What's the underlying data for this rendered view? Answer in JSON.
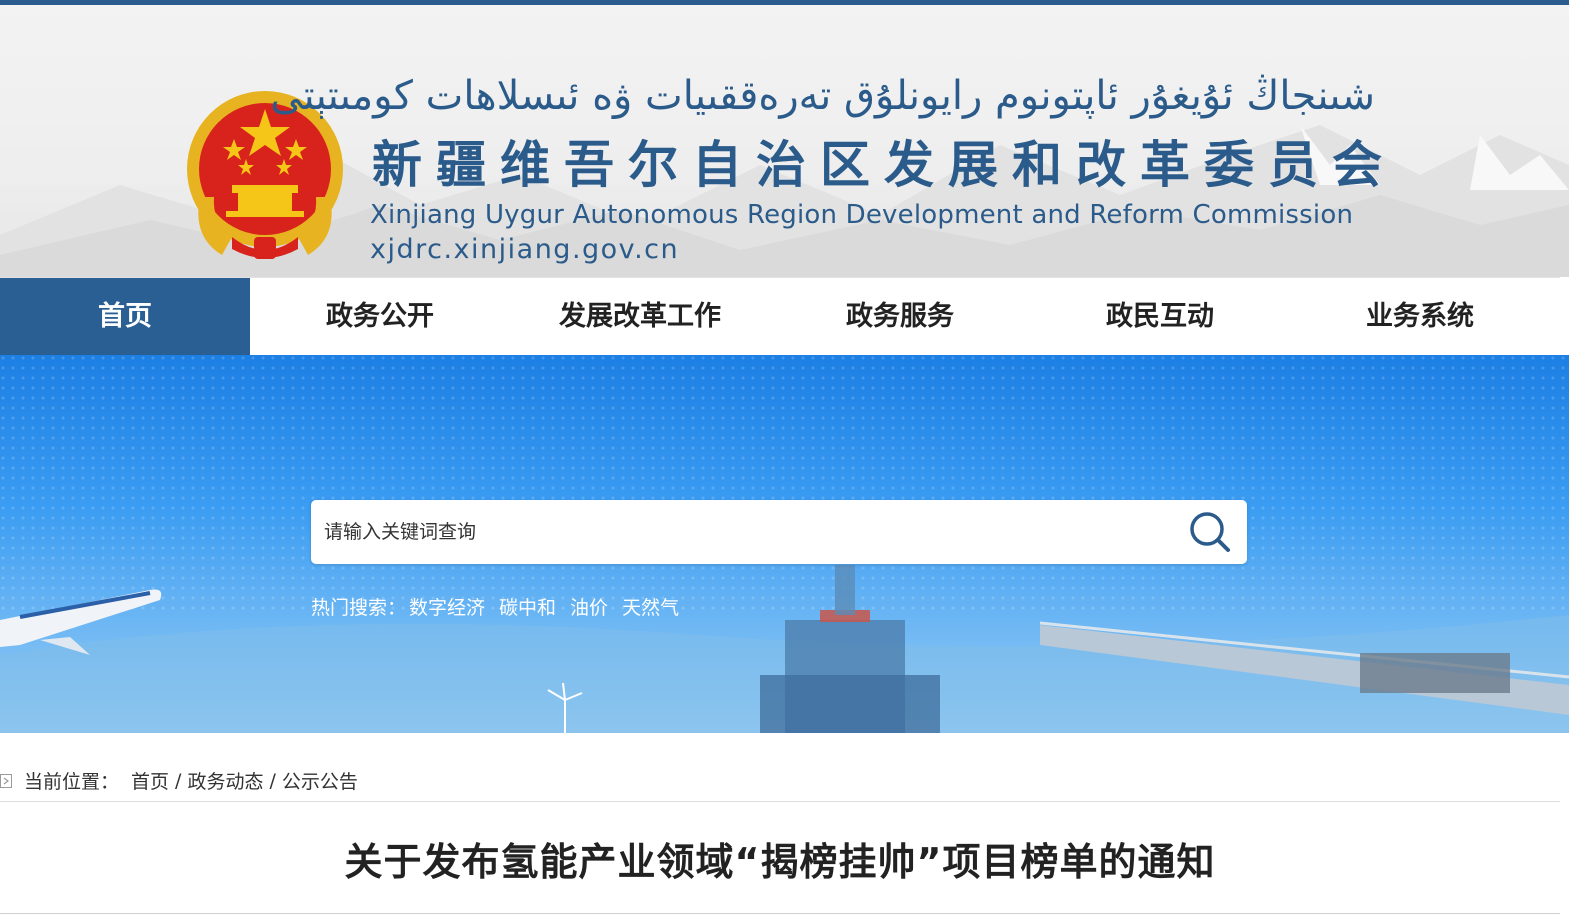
{
  "header": {
    "title_ug": "شىنجاڭ ئۇيغۇر ئاپتونوم رايونلۇق تەرەققىيات ۋە ئىسلاھات كومىتېتى",
    "title_cn": "新疆维吾尔自治区发展和改革委员会",
    "title_en": "Xinjiang Uygur Autonomous Region Development and Reform Commission",
    "url": "xjdrc.xinjiang.gov.cn",
    "emblem_icon": "national-emblem-icon"
  },
  "nav": {
    "items": [
      {
        "label": "首页",
        "active": true
      },
      {
        "label": "政务公开",
        "active": false
      },
      {
        "label": "发展改革工作",
        "active": false
      },
      {
        "label": "政务服务",
        "active": false
      },
      {
        "label": "政民互动",
        "active": false
      },
      {
        "label": "业务系统",
        "active": false
      }
    ]
  },
  "search": {
    "placeholder": "请输入关键词查询",
    "icon": "search-icon",
    "hot_label": "热门搜索：",
    "hot_terms": [
      "数字经济",
      "碳中和",
      "油价",
      "天然气"
    ]
  },
  "breadcrumb": {
    "label": "当前位置：",
    "items": [
      "首页",
      "政务动态",
      "公示公告"
    ],
    "separator": "/"
  },
  "article": {
    "title": "关于发布氢能产业领域“揭榜挂帅”项目榜单的通知"
  },
  "colors": {
    "brand": "#2b5b8a",
    "nav_active": "#2a5f94",
    "banner": "#1c7fe3"
  }
}
